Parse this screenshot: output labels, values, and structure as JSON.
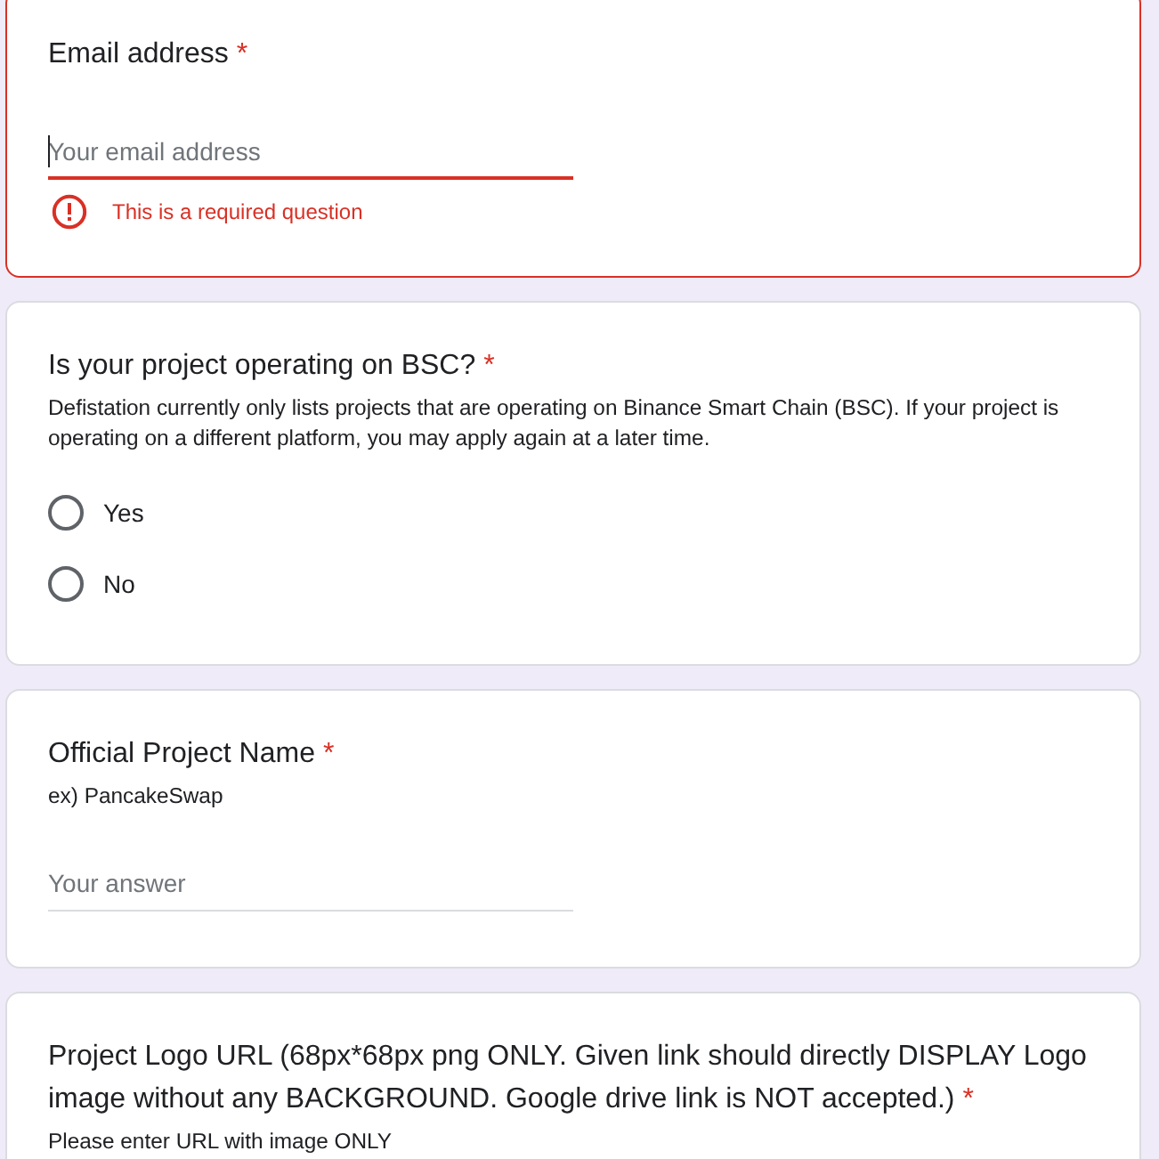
{
  "questions": [
    {
      "kind": "text",
      "title": "Email address",
      "required_mark": "*",
      "placeholder": "Your email address",
      "focused": true,
      "error": "This is a required question"
    },
    {
      "kind": "radio",
      "title": "Is your project operating on BSC?",
      "required_mark": "*",
      "description": "Defistation currently only lists projects that are operating on Binance Smart Chain (BSC). If your project is operating on a different platform, you may apply again at a later time.",
      "options": [
        {
          "label": "Yes",
          "selected": false
        },
        {
          "label": "No",
          "selected": false
        }
      ]
    },
    {
      "kind": "text",
      "title": "Official Project Name",
      "required_mark": "*",
      "description": "ex) PancakeSwap",
      "placeholder": "Your answer",
      "focused": false
    },
    {
      "kind": "text",
      "title": "Project Logo URL (68px*68px png ONLY. Given link should directly DISPLAY Logo image without any BACKGROUND. Google drive link is NOT accepted.)",
      "required_mark": "*",
      "description": "Please enter URL with image ONLY"
    }
  ]
}
